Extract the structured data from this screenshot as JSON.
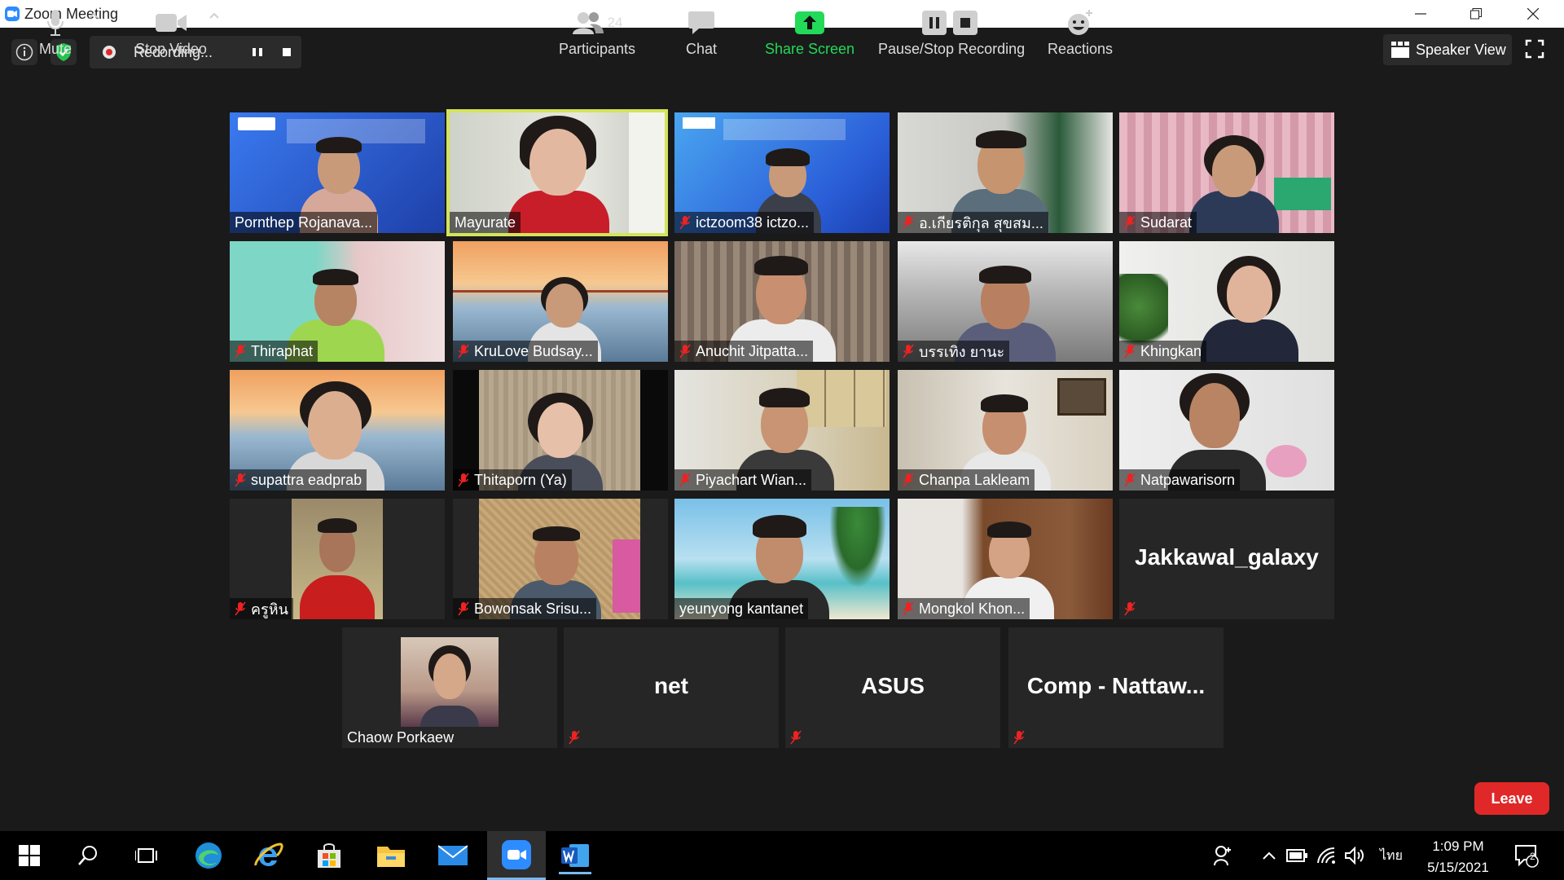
{
  "window": {
    "title": "Zoom Meeting"
  },
  "recording": {
    "status": "Recording..."
  },
  "view": {
    "speaker_view_label": "Speaker View"
  },
  "participants": [
    {
      "name": "Pornthep Rojanava...",
      "muted": false,
      "active": false
    },
    {
      "name": "Mayurate",
      "muted": false,
      "active": true
    },
    {
      "name": "ictzoom38 ictzo...",
      "muted": true,
      "active": false
    },
    {
      "name": "อ.เกียรติกุล สุขสม...",
      "muted": true,
      "active": false
    },
    {
      "name": "Sudarat",
      "muted": true,
      "active": false
    },
    {
      "name": "Thiraphat",
      "muted": true,
      "active": false
    },
    {
      "name": "KruLove Budsay...",
      "muted": true,
      "active": false
    },
    {
      "name": "Anuchit Jitpatta...",
      "muted": true,
      "active": false
    },
    {
      "name": "บรรเทิง ยานะ",
      "muted": true,
      "active": false
    },
    {
      "name": "Khingkan",
      "muted": true,
      "active": false
    },
    {
      "name": "supattra eadprab",
      "muted": true,
      "active": false
    },
    {
      "name": "Thitaporn (Ya)",
      "muted": true,
      "active": false
    },
    {
      "name": "Piyachart Wian...",
      "muted": true,
      "active": false
    },
    {
      "name": "Chanpa Lakleam",
      "muted": true,
      "active": false
    },
    {
      "name": "Natpawarisorn",
      "muted": true,
      "active": false
    },
    {
      "name": "ครูหิน",
      "muted": true,
      "active": false
    },
    {
      "name": "Bowonsak Srisu...",
      "muted": true,
      "active": false
    },
    {
      "name": "yeunyong kantanet",
      "muted": false,
      "active": false
    },
    {
      "name": "Mongkol Khon...",
      "muted": true,
      "active": false
    },
    {
      "name": "Jakkawal_galaxy",
      "muted": true,
      "active": false,
      "video_off": true
    },
    {
      "name": "Chaow Porkaew",
      "muted": false,
      "active": false
    },
    {
      "name": "net",
      "muted": true,
      "active": false,
      "video_off": true
    },
    {
      "name": "ASUS",
      "muted": true,
      "active": false,
      "video_off": true
    },
    {
      "name": "Comp - Nattaw...",
      "muted": true,
      "active": false,
      "video_off": true
    }
  ],
  "toolbar": {
    "mute_label": "Mute",
    "stop_video_label": "Stop Video",
    "participants_label": "Participants",
    "participants_count": "24",
    "chat_label": "Chat",
    "share_screen_label": "Share Screen",
    "pause_stop_recording_label": "Pause/Stop Recording",
    "reactions_label": "Reactions",
    "leave_label": "Leave"
  },
  "taskbar": {
    "language": "ไทย",
    "time": "1:09 PM",
    "date": "5/15/2021",
    "notification_count": "2"
  },
  "colors": {
    "accent_active": "#d4e45a",
    "share_green": "#23d959",
    "leave_red": "#e02828",
    "zoom_blue": "#2d8cff"
  }
}
